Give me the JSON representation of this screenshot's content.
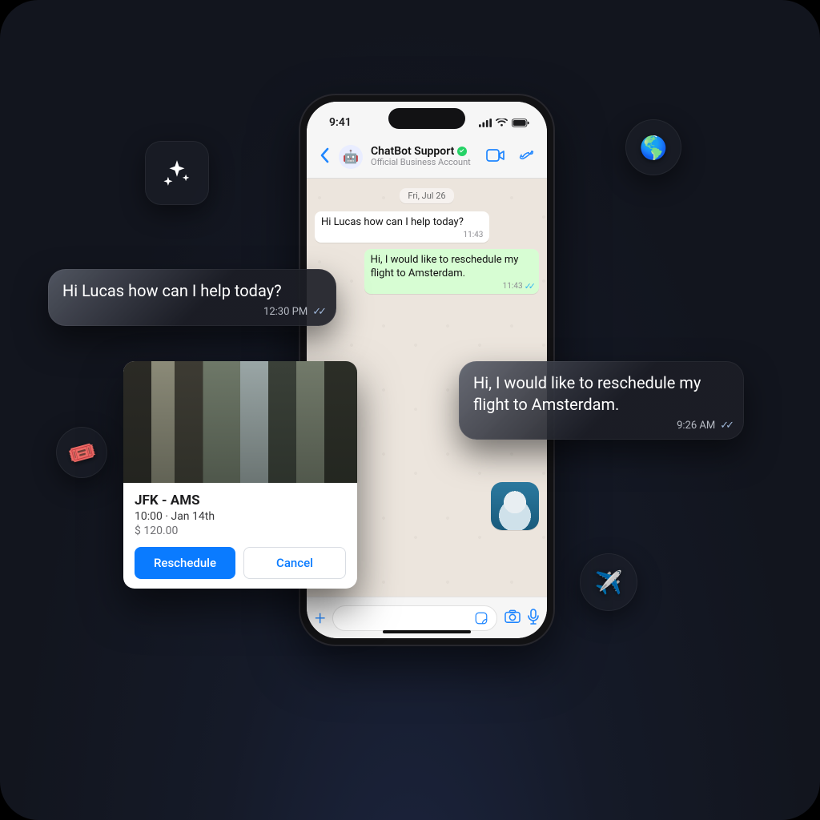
{
  "status": {
    "time": "9:41"
  },
  "header": {
    "name": "ChatBot Support",
    "subtitle": "Official Business Account"
  },
  "chat": {
    "date_chip": "Fri, Jul 26",
    "msg_in": {
      "text": "Hi Lucas how can I help today?",
      "time": "11:43"
    },
    "msg_out": {
      "text": "Hi, I would like to reschedule my flight to Amsterdam.",
      "time": "11:43"
    }
  },
  "float_left": {
    "text": "Hi Lucas how can I help today?",
    "time": "12:30 PM"
  },
  "float_right": {
    "text": "Hi, I would like to reschedule my flight to Amsterdam.",
    "time": "9:26 AM"
  },
  "flight": {
    "route": "JFK - AMS",
    "when": "10:00 · Jan 14th",
    "price": "$ 120.00",
    "reschedule_label": "Reschedule",
    "cancel_label": "Cancel"
  },
  "icons": {
    "globe": "🌎",
    "ticket": "🎟️",
    "plane": "✈️"
  }
}
